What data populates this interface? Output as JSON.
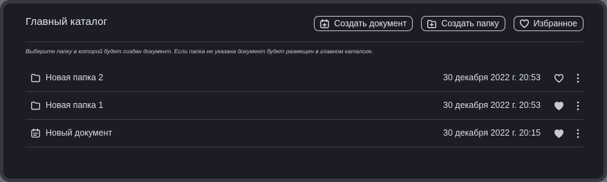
{
  "catalog": {
    "title": "Главный каталог",
    "hint": "Выберите папку в которой будет создан документ. Если папка не указана документ будет размещен в главном каталоге."
  },
  "toolbar": {
    "create_document_label": "Создать документ",
    "create_folder_label": "Создать папку",
    "favorites_label": "Избранное"
  },
  "items": [
    {
      "type": "folder",
      "icon": "folder-icon",
      "name": "Новая папка 2",
      "date": "30 декабря 2022 г. 20:53",
      "favorite": false
    },
    {
      "type": "folder",
      "icon": "folder-icon",
      "name": "Новая папка 1",
      "date": "30 декабря 2022 г. 20:53",
      "favorite": true
    },
    {
      "type": "document",
      "icon": "document-icon",
      "name": "Новый документ",
      "date": "30 декабря 2022 г. 20:15",
      "favorite": true
    }
  ],
  "colors": {
    "panel_background": "#1b1c24",
    "frame": "#37373d",
    "text": "#dcdce2",
    "favorite_fill": "#c8c8d4"
  }
}
